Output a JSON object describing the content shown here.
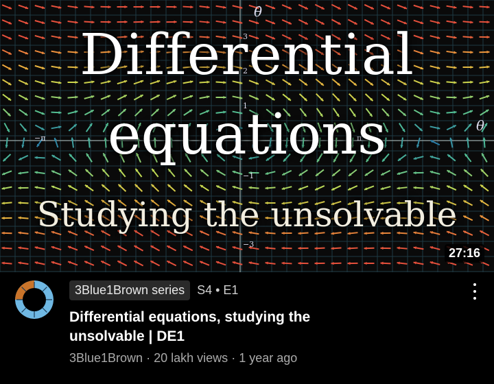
{
  "thumbnail": {
    "title_line1": "Differential",
    "title_line2": "equations",
    "subtitle": "Studying the unsolvable",
    "duration": "27:16",
    "axis_labels": {
      "theta": "θ",
      "theta_dot": "θ̇",
      "y3": "3",
      "y2": "2",
      "y1": "1",
      "ym1": "−1",
      "ym3": "−3",
      "pi": "π",
      "neg_pi": "−π"
    }
  },
  "video": {
    "series_label": "3Blue1Brown series",
    "episode": "S4 • E1",
    "title": "Differential equations, studying the unsolvable | DE1",
    "channel": "3Blue1Brown",
    "views": "20 lakh views",
    "age": "1 year ago",
    "separator": "·"
  },
  "colors": {
    "background": "#000000",
    "chip": "#2a2a2a",
    "muted_text": "#aaaaaa"
  },
  "icons": {
    "more": "more-vert-icon",
    "avatar": "channel-avatar"
  }
}
